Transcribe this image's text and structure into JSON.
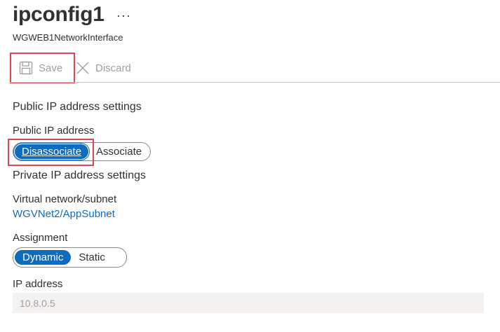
{
  "header": {
    "title": "ipconfig1",
    "more": "···",
    "subtitle": "WGWEB1NetworkInterface"
  },
  "toolbar": {
    "save_label": "Save",
    "discard_label": "Discard"
  },
  "public_ip": {
    "heading": "Public IP address settings",
    "label": "Public IP address",
    "options": [
      "Disassociate",
      "Associate"
    ],
    "selected": "Disassociate"
  },
  "private_ip": {
    "heading": "Private IP address settings",
    "vnet_label": "Virtual network/subnet",
    "vnet_value": "WGVNet2/AppSubnet",
    "assignment_label": "Assignment",
    "assignment_options": [
      "Dynamic",
      "Static"
    ],
    "assignment_selected": "Dynamic",
    "ip_label": "IP address",
    "ip_value": "10.8.0.5"
  },
  "colors": {
    "accent": "#0f6cbd",
    "highlight": "#e0454e",
    "disabled_text": "#a19f9d"
  }
}
